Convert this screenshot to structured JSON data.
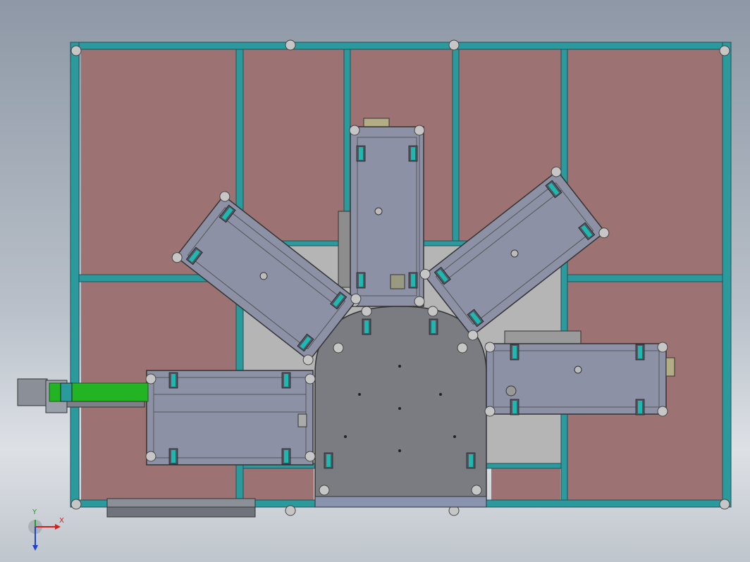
{
  "colors": {
    "background_top": "#8e98a6",
    "panel_fill": "#9c7272",
    "frame_teal": "#2a9a9c",
    "frame_dark": "#24505a",
    "module_fill": "#8a8ea4",
    "module_border": "#3a3a40",
    "base_plate": "#777a80",
    "floor_light": "#b6b6b6",
    "conveyor_green": "#22b422",
    "knob_gray": "#c4c4c4",
    "axis_x": "#d02020",
    "axis_y": "#20a020",
    "axis_z": "#2040d0"
  },
  "triad": {
    "x_label": "X",
    "y_label": "Y"
  },
  "icons": {
    "view_triad": "xyz-triad-icon",
    "leveling_foot": "circle-knob-icon",
    "linear_guide": "teal-rail-icon"
  }
}
